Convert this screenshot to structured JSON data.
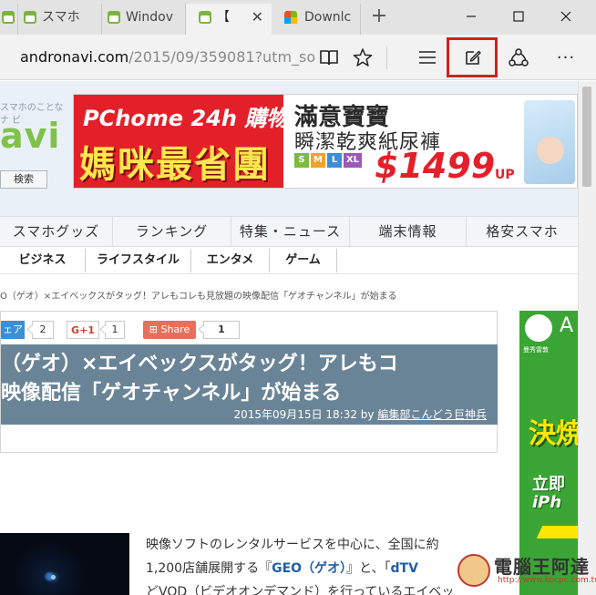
{
  "window": {
    "tabs": [
      {
        "label": "スマホ",
        "favicon": "android-icon",
        "active": false
      },
      {
        "label": "Windov",
        "favicon": "android-icon",
        "active": false
      },
      {
        "label": "【",
        "favicon": "android-icon",
        "active": true
      },
      {
        "label": "Downlc",
        "favicon": "windows-icon",
        "active": false
      }
    ],
    "close_tab_glyph": "✕",
    "new_tab_glyph": "+",
    "minimize_glyph": "—",
    "maximize_glyph": "☐",
    "close_glyph": "✕"
  },
  "addressbar": {
    "host": "andronavi.com",
    "path": "/2015/09/359081?utm_so",
    "more_glyph": "···"
  },
  "site": {
    "tagline_1": "スマホのことな",
    "tagline_2": "ナ ビ",
    "logo": "avi",
    "search_button": "検索",
    "banner": {
      "pchome": "PChome 24h 購物",
      "headline": "媽咪最省團",
      "title": "滿意寶寶",
      "subtitle": "瞬潔乾爽紙尿褲",
      "sizes": [
        "S",
        "M",
        "L",
        "XL"
      ],
      "price": "$1499",
      "price_suffix": "UP"
    },
    "menu_primary": [
      "スマホグッズ",
      "ランキング",
      "特集・ニュース",
      "端末情報",
      "格安スマホ"
    ],
    "menu_secondary": [
      "ビジネス",
      "ライフスタイル",
      "エンタメ",
      "ゲーム"
    ]
  },
  "article": {
    "breadcrumb": "O（ゲオ）×エイベックスがタッグ！アレもコレも見放題の映像配信「ゲオチャンネル」が始まる",
    "share": [
      {
        "label": "ェア",
        "count": "2"
      },
      {
        "label": "G+1",
        "count": "1"
      },
      {
        "label": "Share",
        "count": "1"
      }
    ],
    "title_line_1": "（ゲオ）×エイベックスがタッグ！アレもコ",
    "title_line_2": "映像配信「ゲオチャンネル」が始まる",
    "date": "2015年09月15日 18:32 by",
    "author": "編集部こんどう巨神兵",
    "body_1": "映像ソフトのレンタルサービスを中心に、全国に約",
    "body_2a": "1,200店舗展開する『",
    "body_2b": "GEO（ゲオ）",
    "body_2c": "』と、「",
    "body_2d": "dTV",
    "body_3": "どVOD（ビデオオンデマンド）を行っているエイベッ"
  },
  "side_ad": {
    "a": "A",
    "small": "曼秀雷敦",
    "big": "決焼",
    "line1": "立即",
    "line2": "iPh"
  },
  "watermark": {
    "text": "電腦王阿達",
    "url": "http://www.kocpc.com.tw"
  }
}
